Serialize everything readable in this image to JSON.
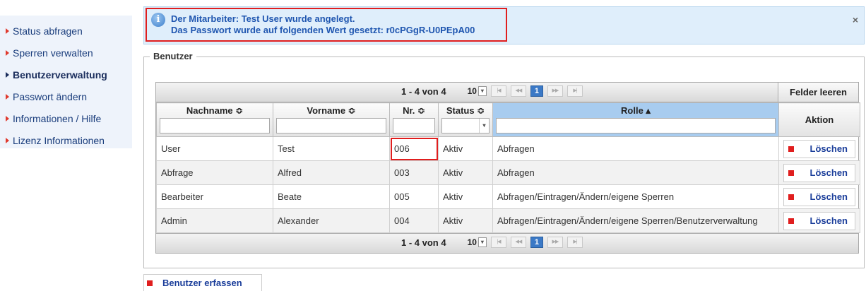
{
  "sidebar": {
    "items": [
      {
        "label": "Status abfragen"
      },
      {
        "label": "Sperren verwalten"
      },
      {
        "label": "Benutzerverwaltung"
      },
      {
        "label": "Passwort ändern"
      },
      {
        "label": "Informationen / Hilfe"
      },
      {
        "label": "Lizenz Informationen"
      }
    ]
  },
  "info": {
    "icon": "info-icon",
    "line1": "Der Mitarbeiter: Test User wurde angelegt.",
    "line2": "Das Passwort wurde auf folgenden Wert gesetzt: r0cPGgR-U0PEpA00",
    "close": "×"
  },
  "fieldset": {
    "legend": "Benutzer"
  },
  "pager": {
    "count": "1 - 4 von 4",
    "rows_per_page": "10",
    "current_page": "1",
    "clear_fields": "Felder leeren"
  },
  "columns": {
    "nachname": "Nachname ≎",
    "vorname": "Vorname ≎",
    "nr": "Nr. ≎",
    "status": "Status ≎",
    "rolle": "Rolle ▴",
    "aktion": "Aktion"
  },
  "rows": [
    {
      "nachname": "User",
      "vorname": "Test",
      "nr": "006",
      "status": "Aktiv",
      "rolle": "Abfragen",
      "action": "Löschen"
    },
    {
      "nachname": "Abfrage",
      "vorname": "Alfred",
      "nr": "003",
      "status": "Aktiv",
      "rolle": "Abfragen",
      "action": "Löschen"
    },
    {
      "nachname": "Bearbeiter",
      "vorname": "Beate",
      "nr": "005",
      "status": "Aktiv",
      "rolle": "Abfragen/Eintragen/Ändern/eigene Sperren",
      "action": "Löschen"
    },
    {
      "nachname": "Admin",
      "vorname": "Alexander",
      "nr": "004",
      "status": "Aktiv",
      "rolle": "Abfragen/Eintragen/Ändern/eigene Sperren/Benutzerverwaltung",
      "action": "Löschen"
    }
  ],
  "create_button": "Benutzer erfassen",
  "colors": {
    "accent": "#e01e1e",
    "link": "#1a3d9a",
    "info_bg": "#dfeefb",
    "sorted_header": "#a8ccef"
  }
}
